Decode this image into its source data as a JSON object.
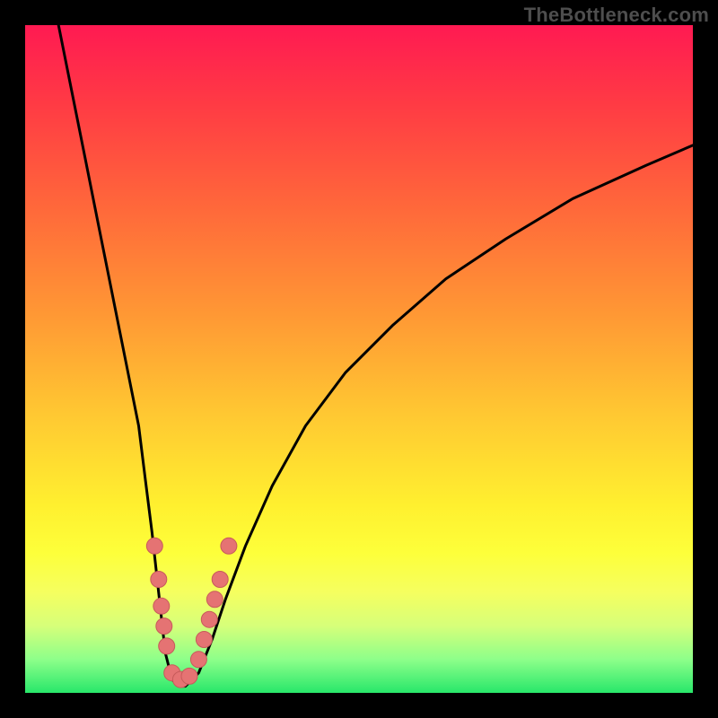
{
  "watermark": "TheBottleneck.com",
  "colors": {
    "curve": "#000000",
    "dot_fill": "#e57373",
    "dot_stroke": "#c75a5a",
    "frame": "#000000"
  },
  "chart_data": {
    "type": "line",
    "title": "",
    "xlabel": "",
    "ylabel": "",
    "xlim": [
      0,
      100
    ],
    "ylim": [
      0,
      100
    ],
    "series": [
      {
        "name": "bottleneck-curve",
        "x": [
          5,
          7,
          9,
          11,
          13,
          15,
          17,
          18,
          19,
          20,
          21,
          22,
          23,
          24,
          26,
          28,
          30,
          33,
          37,
          42,
          48,
          55,
          63,
          72,
          82,
          93,
          100
        ],
        "y": [
          100,
          90,
          80,
          70,
          60,
          50,
          40,
          32,
          24,
          15,
          6,
          2,
          1,
          1,
          3,
          8,
          14,
          22,
          31,
          40,
          48,
          55,
          62,
          68,
          74,
          79,
          82
        ]
      }
    ],
    "points": [
      {
        "name": "cluster-left-top",
        "x": 19.4,
        "y": 22
      },
      {
        "name": "cluster-left-a",
        "x": 20.0,
        "y": 17
      },
      {
        "name": "cluster-left-b",
        "x": 20.4,
        "y": 13
      },
      {
        "name": "cluster-left-c",
        "x": 20.8,
        "y": 10
      },
      {
        "name": "cluster-left-d",
        "x": 21.2,
        "y": 7
      },
      {
        "name": "cluster-bottom-a",
        "x": 22.0,
        "y": 3
      },
      {
        "name": "cluster-bottom-b",
        "x": 23.3,
        "y": 2
      },
      {
        "name": "cluster-bottom-c",
        "x": 24.6,
        "y": 2.5
      },
      {
        "name": "cluster-right-a",
        "x": 26.0,
        "y": 5
      },
      {
        "name": "cluster-right-b",
        "x": 26.8,
        "y": 8
      },
      {
        "name": "cluster-right-c",
        "x": 27.6,
        "y": 11
      },
      {
        "name": "cluster-right-d",
        "x": 28.4,
        "y": 14
      },
      {
        "name": "cluster-right-e",
        "x": 29.2,
        "y": 17
      },
      {
        "name": "cluster-right-top",
        "x": 30.5,
        "y": 22
      }
    ]
  }
}
